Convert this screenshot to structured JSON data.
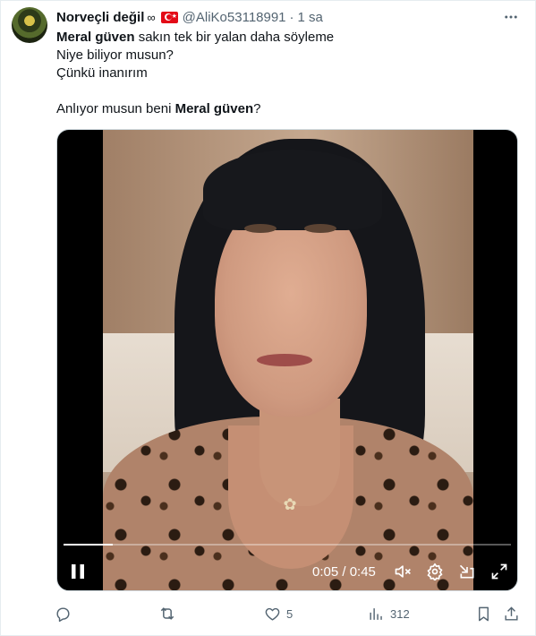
{
  "tweet": {
    "author_name": "Norveçli değil",
    "author_badge": "∞",
    "flag": "turkey-flag",
    "handle": "@AliKo53118991",
    "separator": "·",
    "time": "1 sa",
    "text_lines": [
      {
        "bold": "Meral güven",
        "rest": " sakın tek bir yalan daha söyleme"
      },
      {
        "text": "Niye biliyor musun?"
      },
      {
        "text": "Çünkü inanırım"
      },
      {
        "text": ""
      },
      {
        "before": "Anlıyor musun beni ",
        "bold": "Meral güven",
        "after": "?"
      }
    ]
  },
  "video": {
    "timecode": "0:05 / 0:45",
    "progress": 0.11,
    "controls": [
      "pause-icon",
      "mute-icon",
      "settings-icon",
      "minimize-player-icon",
      "fullscreen-icon"
    ]
  },
  "actions": {
    "reply_count": "",
    "retweet_count": "",
    "like_count": "5",
    "view_count": "312"
  },
  "colors": {
    "text_primary": "#0f1419",
    "text_secondary": "#536471",
    "border": "#e6ecf0"
  }
}
